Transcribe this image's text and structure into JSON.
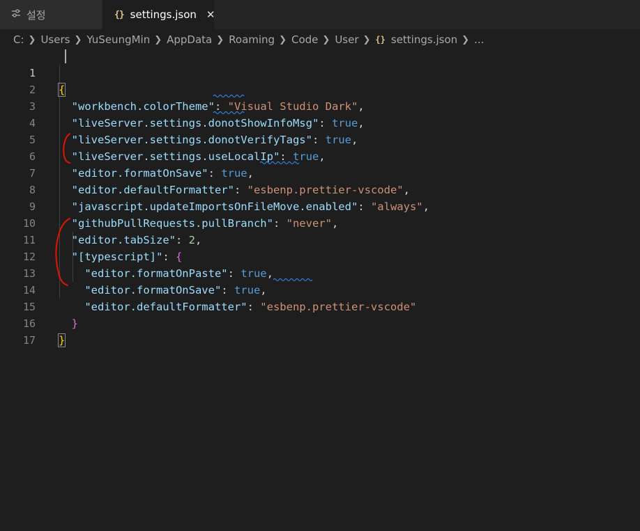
{
  "tabs": [
    {
      "label": "설정",
      "icon": "settings-sliders-icon",
      "active": false
    },
    {
      "label": "settings.json",
      "icon": "json-braces-icon",
      "active": true,
      "close_glyph": "✕"
    }
  ],
  "breadcrumb": {
    "items": [
      "C:",
      "Users",
      "YuSeungMin",
      "AppData",
      "Roaming",
      "Code",
      "User",
      "settings.json",
      "..."
    ],
    "separator_icon": "chevron-right-icon",
    "file_icon_glyph": "{}"
  },
  "editor": {
    "line_numbers": [
      "1",
      "2",
      "3",
      "4",
      "5",
      "6",
      "7",
      "8",
      "9",
      "10",
      "11",
      "12",
      "13",
      "14",
      "15",
      "16",
      "17"
    ],
    "active_line": "1",
    "lines": [
      {
        "open_brace": "{"
      },
      {
        "key": "\"workbench.colorTheme\"",
        "value": "\"Visual Studio Dark\""
      },
      {
        "key": "\"liveServer.settings.donotShowInfoMsg\"",
        "value": "true"
      },
      {
        "key": "\"liveServer.settings.donotVerifyTags\"",
        "value": "true"
      },
      {
        "key": "\"liveServer.settings.useLocalIp\"",
        "value": "true"
      },
      {
        "key": "\"editor.formatOnSave\"",
        "value": "true"
      },
      {
        "key": "\"editor.defaultFormatter\"",
        "value": "\"esbenp.prettier-vscode\""
      },
      {
        "key": "\"javascript.updateImportsOnFileMove.enabled\"",
        "value": "\"always\""
      },
      {
        "key": "\"githubPullRequests.pullBranch\"",
        "value": "\"never\""
      },
      {
        "key": "\"editor.tabSize\"",
        "value": "2"
      },
      {
        "key": "\"[typescript]\"",
        "value": "{"
      },
      {
        "key": "\"editor.formatOnPaste\"",
        "value": "true"
      },
      {
        "key": "\"editor.formatOnSave\"",
        "value": "true"
      },
      {
        "key": "\"editor.defaultFormatter\"",
        "value": "\"esbenp.prettier-vscode\""
      },
      {
        "close_brace": "}"
      },
      {
        "close_brace": "}"
      }
    ]
  },
  "colors": {
    "background": "#1e1e1e",
    "key": "#9cdcfe",
    "string": "#ce9178",
    "boolean": "#569cd6",
    "number": "#b5cea8",
    "annotation": "#e51400"
  }
}
